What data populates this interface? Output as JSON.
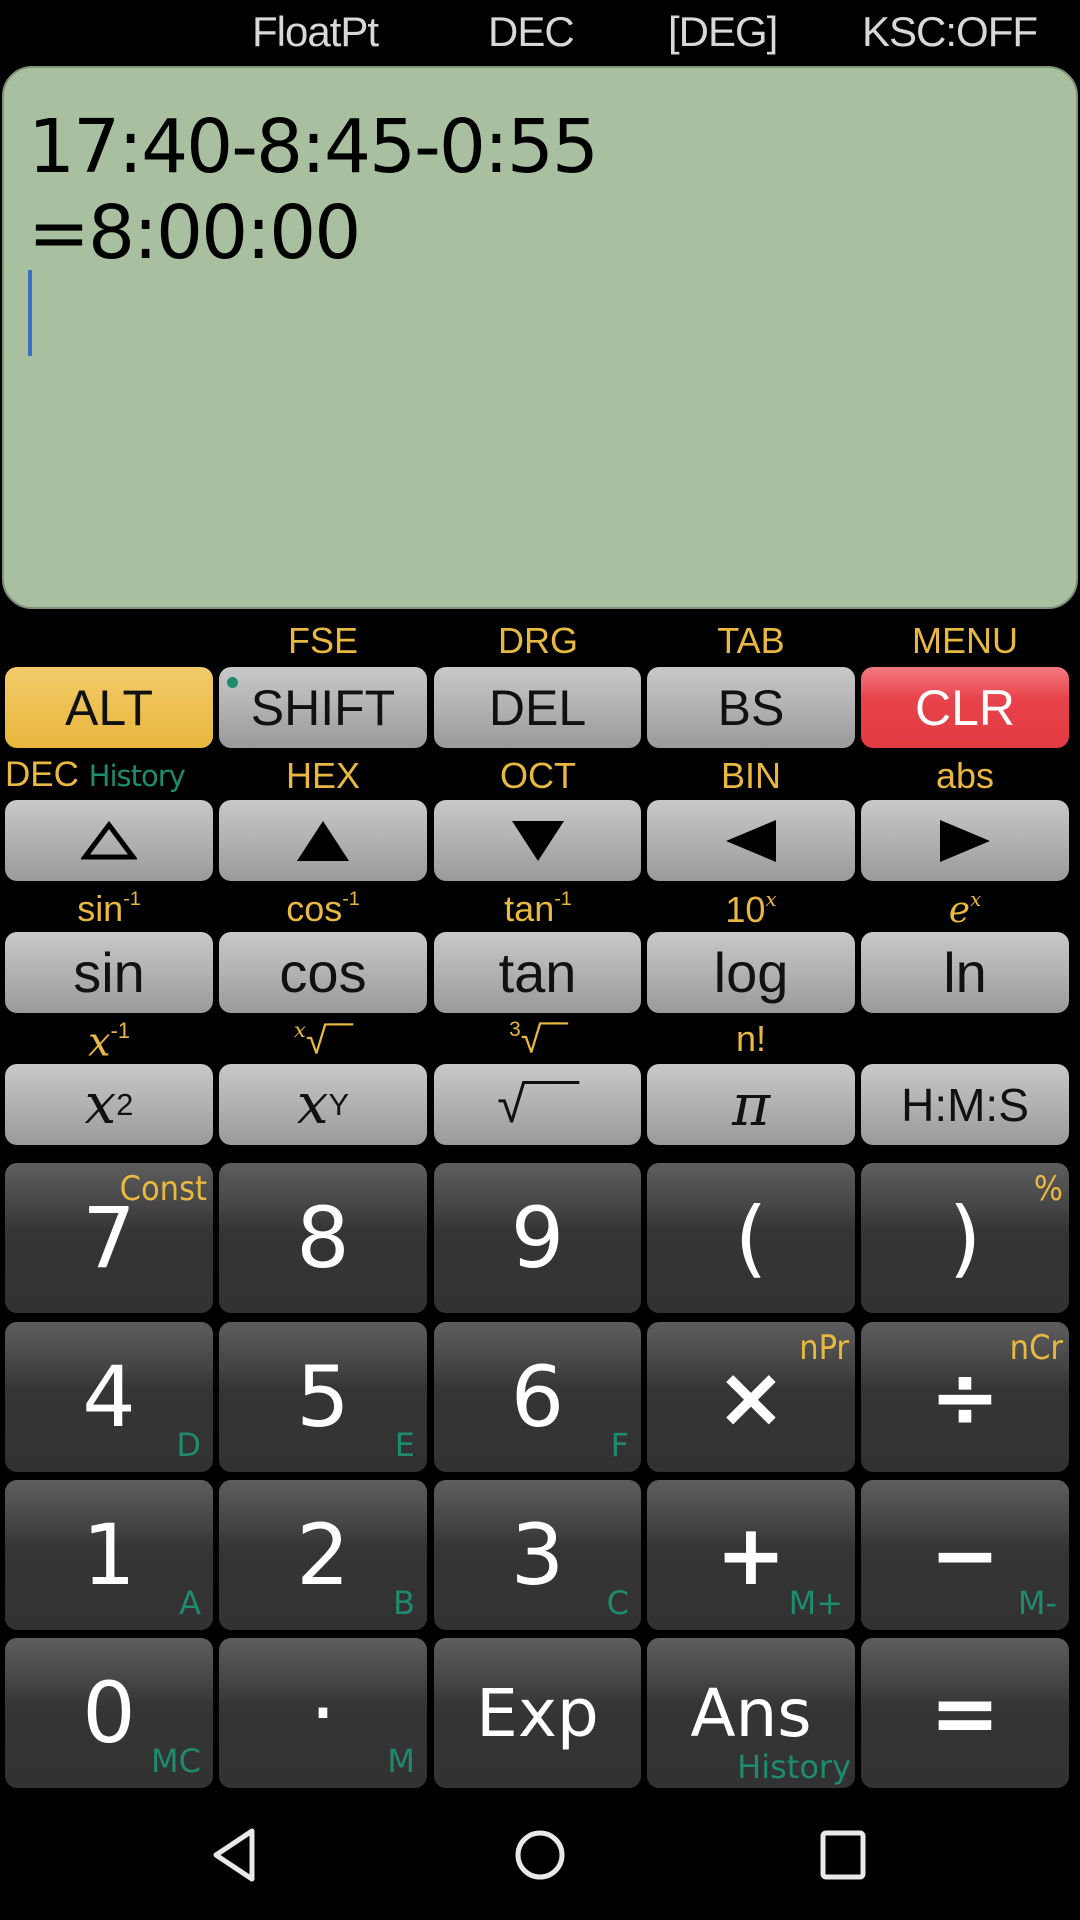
{
  "status": {
    "format": "FloatPt",
    "base": "DEC",
    "angle": "[DEG]",
    "ksc": "KSC:OFF"
  },
  "display": {
    "expression": "17:40-8:45-0:55",
    "result": "=8:00:00"
  },
  "row1": {
    "labels": [
      "",
      "FSE",
      "DRG",
      "TAB",
      "MENU"
    ],
    "keys": [
      "ALT",
      "SHIFT",
      "DEL",
      "BS",
      "CLR"
    ]
  },
  "row2": {
    "labels": [
      "DEC",
      "HEX",
      "OCT",
      "BIN",
      "abs"
    ],
    "label_green": "History",
    "keys": [
      "triangle-outline-up",
      "arrow-up",
      "arrow-down",
      "arrow-left",
      "arrow-right"
    ]
  },
  "row3": {
    "labels": [
      "sin",
      "cos",
      "tan",
      "10",
      "e"
    ],
    "label_sups": [
      "-1",
      "-1",
      "-1",
      "x",
      "x"
    ],
    "keys": [
      "sin",
      "cos",
      "tan",
      "log",
      "ln"
    ]
  },
  "row4": {
    "labels": [
      "x",
      "√‾‾",
      "√‾‾",
      "n!",
      ""
    ],
    "label_pre_sups": [
      "",
      "x",
      "3",
      "",
      ""
    ],
    "label_sups": [
      "-1",
      "",
      "",
      "",
      ""
    ],
    "keys": [
      "x",
      "x",
      "√‾‾‾",
      "π",
      "H:M:S"
    ],
    "key_sups": [
      "2",
      "Y",
      "",
      "",
      ""
    ]
  },
  "numpad": [
    [
      {
        "main": "7",
        "tr": "Const",
        "br": ""
      },
      {
        "main": "8",
        "tr": "",
        "br": ""
      },
      {
        "main": "9",
        "tr": "",
        "br": ""
      },
      {
        "main": "(",
        "tr": "",
        "br": ""
      },
      {
        "main": ")",
        "tr": "%",
        "br": ""
      }
    ],
    [
      {
        "main": "4",
        "tr": "",
        "br": "D"
      },
      {
        "main": "5",
        "tr": "",
        "br": "E"
      },
      {
        "main": "6",
        "tr": "",
        "br": "F"
      },
      {
        "main": "×",
        "tr": "nPr",
        "br": ""
      },
      {
        "main": "÷",
        "tr": "nCr",
        "br": ""
      }
    ],
    [
      {
        "main": "1",
        "tr": "",
        "br": "A"
      },
      {
        "main": "2",
        "tr": "",
        "br": "B"
      },
      {
        "main": "3",
        "tr": "",
        "br": "C"
      },
      {
        "main": "+",
        "tr": "",
        "br": "M+"
      },
      {
        "main": "−",
        "tr": "",
        "br": "M-"
      }
    ],
    [
      {
        "main": "0",
        "tr": "",
        "br": "MC"
      },
      {
        "main": "·",
        "tr": "",
        "br": "M"
      },
      {
        "main": "Exp",
        "tr": "",
        "br": ""
      },
      {
        "main": "Ans",
        "tr": "",
        "br": "History"
      },
      {
        "main": "=",
        "tr": "",
        "br": ""
      }
    ]
  ],
  "nav": [
    "back",
    "home",
    "recents"
  ],
  "colors": {
    "display_bg": "#a8c0a0",
    "alt_key": "#e8b63c",
    "clr_key": "#e23b42",
    "label_yellow": "#e8b840",
    "label_green": "#1e8a6e",
    "cursor": "#3a6fc8"
  }
}
